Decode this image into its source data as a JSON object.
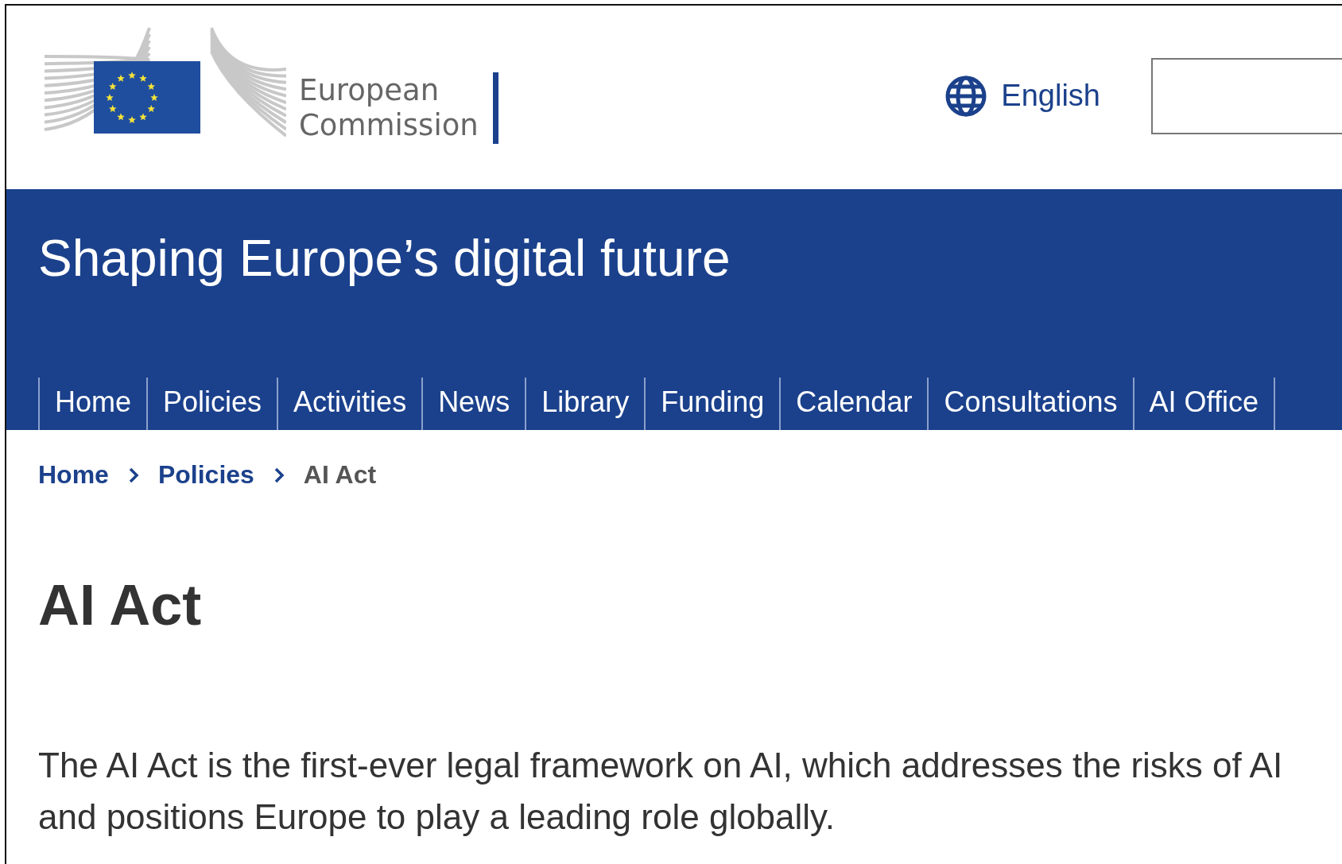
{
  "header": {
    "logo_text": [
      "European",
      "Commission"
    ],
    "language": "English"
  },
  "site_title": "Shaping Europe’s digital future",
  "nav": [
    {
      "label": "Home"
    },
    {
      "label": "Policies"
    },
    {
      "label": "Activities"
    },
    {
      "label": "News"
    },
    {
      "label": "Library"
    },
    {
      "label": "Funding"
    },
    {
      "label": "Calendar"
    },
    {
      "label": "Consultations"
    },
    {
      "label": "AI Office"
    }
  ],
  "breadcrumb": [
    {
      "label": "Home",
      "current": false
    },
    {
      "label": "Policies",
      "current": false
    },
    {
      "label": "AI Act",
      "current": true
    }
  ],
  "page_title": "AI Act",
  "intro": "The AI Act is the first-ever legal framework on AI, which addresses the risks of AI and positions Europe to play a leading role globally."
}
